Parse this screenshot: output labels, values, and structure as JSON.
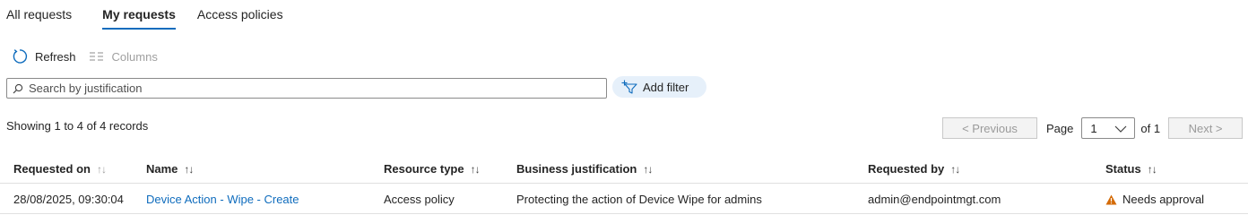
{
  "tabs": [
    {
      "label": "All requests",
      "active": false
    },
    {
      "label": "My requests",
      "active": true
    },
    {
      "label": "Access policies",
      "active": false
    }
  ],
  "toolbar": {
    "refresh_label": "Refresh",
    "refresh_icon": "refresh-icon",
    "columns_label": "Columns",
    "columns_icon": "columns-icon"
  },
  "search": {
    "placeholder": "Search by justification",
    "value": "",
    "icon": "search-icon"
  },
  "filter": {
    "label": "Add filter",
    "icon": "add-filter-icon"
  },
  "results": {
    "showing_text": "Showing 1 to 4 of 4 records"
  },
  "pagination": {
    "previous_label": "< Previous",
    "page_label": "Page",
    "current_page": "1",
    "of_label": "of 1",
    "next_label": "Next >"
  },
  "table": {
    "columns": [
      {
        "label": "Requested on",
        "sort": "↑↓"
      },
      {
        "label": "Name",
        "sort": "↑↓"
      },
      {
        "label": "Resource type",
        "sort": "↑↓"
      },
      {
        "label": "Business justification",
        "sort": "↑↓"
      },
      {
        "label": "Requested by",
        "sort": "↑↓"
      },
      {
        "label": "Status",
        "sort": "↑↓"
      }
    ],
    "rows": [
      {
        "requested_on": "28/08/2025, 09:30:04",
        "name": "Device Action - Wipe - Create",
        "resource_type": "Access policy",
        "justification": "Protecting the action of Device Wipe for admins",
        "requested_by": "admin@endpointmgt.com",
        "status": "Needs approval",
        "status_icon": "warning-icon"
      }
    ]
  },
  "colors": {
    "accent": "#0f6cbd",
    "warning": "#d46b08",
    "filter_bg": "#e6f0fa"
  }
}
